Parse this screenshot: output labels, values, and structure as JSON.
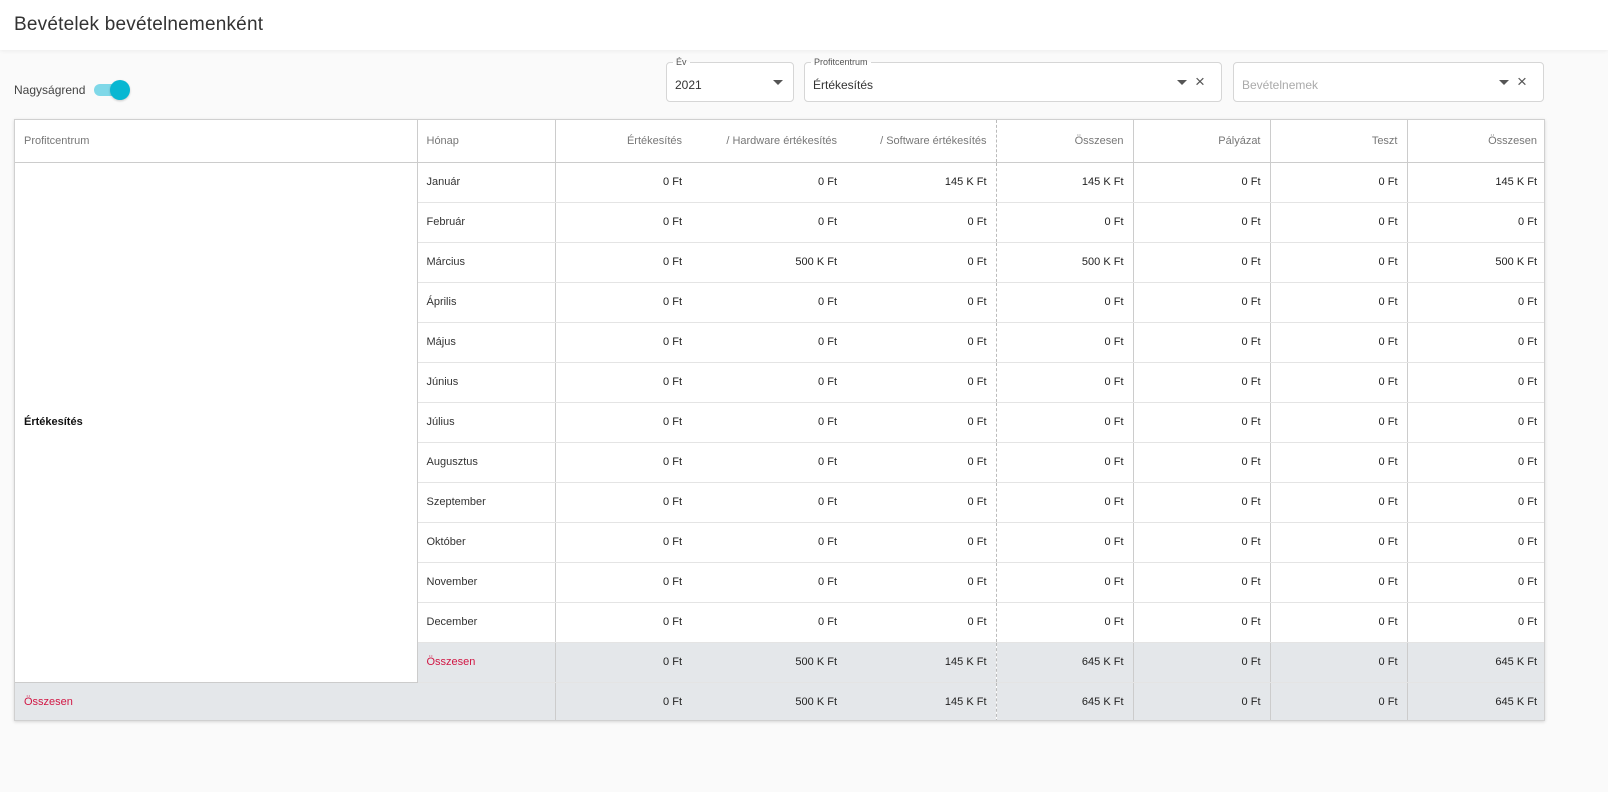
{
  "page": {
    "title": "Bevételek bevételnemenként"
  },
  "toggle": {
    "label": "Nagyságrend",
    "on": true
  },
  "filters": {
    "year": {
      "legend": "Év",
      "value": "2021"
    },
    "profitcenter": {
      "legend": "Profitcentrum",
      "value": "Értékesítés"
    },
    "revenue_types": {
      "placeholder": "Bevételnemek"
    }
  },
  "table": {
    "headers": {
      "profitcenter": "Profitcentrum",
      "month": "Hónap",
      "c1": "Értékesítés",
      "c2": "/ Hardware értékesítés",
      "c3": "/ Software értékesítés",
      "c4": "Összesen",
      "c5": "Pályázat",
      "c6": "Teszt",
      "c7": "Összesen"
    },
    "group_label": "Értékesítés",
    "rows": [
      {
        "month": "Január",
        "values": [
          "0 Ft",
          "0 Ft",
          "145 K Ft",
          "145 K Ft",
          "0 Ft",
          "0 Ft",
          "145 K Ft"
        ]
      },
      {
        "month": "Február",
        "values": [
          "0 Ft",
          "0 Ft",
          "0 Ft",
          "0 Ft",
          "0 Ft",
          "0 Ft",
          "0 Ft"
        ]
      },
      {
        "month": "Március",
        "values": [
          "0 Ft",
          "500 K Ft",
          "0 Ft",
          "500 K Ft",
          "0 Ft",
          "0 Ft",
          "500 K Ft"
        ]
      },
      {
        "month": "Április",
        "values": [
          "0 Ft",
          "0 Ft",
          "0 Ft",
          "0 Ft",
          "0 Ft",
          "0 Ft",
          "0 Ft"
        ]
      },
      {
        "month": "Május",
        "values": [
          "0 Ft",
          "0 Ft",
          "0 Ft",
          "0 Ft",
          "0 Ft",
          "0 Ft",
          "0 Ft"
        ]
      },
      {
        "month": "Június",
        "values": [
          "0 Ft",
          "0 Ft",
          "0 Ft",
          "0 Ft",
          "0 Ft",
          "0 Ft",
          "0 Ft"
        ]
      },
      {
        "month": "Július",
        "values": [
          "0 Ft",
          "0 Ft",
          "0 Ft",
          "0 Ft",
          "0 Ft",
          "0 Ft",
          "0 Ft"
        ]
      },
      {
        "month": "Augusztus",
        "values": [
          "0 Ft",
          "0 Ft",
          "0 Ft",
          "0 Ft",
          "0 Ft",
          "0 Ft",
          "0 Ft"
        ]
      },
      {
        "month": "Szeptember",
        "values": [
          "0 Ft",
          "0 Ft",
          "0 Ft",
          "0 Ft",
          "0 Ft",
          "0 Ft",
          "0 Ft"
        ]
      },
      {
        "month": "Október",
        "values": [
          "0 Ft",
          "0 Ft",
          "0 Ft",
          "0 Ft",
          "0 Ft",
          "0 Ft",
          "0 Ft"
        ]
      },
      {
        "month": "November",
        "values": [
          "0 Ft",
          "0 Ft",
          "0 Ft",
          "0 Ft",
          "0 Ft",
          "0 Ft",
          "0 Ft"
        ]
      },
      {
        "month": "December",
        "values": [
          "0 Ft",
          "0 Ft",
          "0 Ft",
          "0 Ft",
          "0 Ft",
          "0 Ft",
          "0 Ft"
        ]
      }
    ],
    "subtotal": {
      "label": "Összesen",
      "values": [
        "0 Ft",
        "500 K Ft",
        "145 K Ft",
        "645 K Ft",
        "0 Ft",
        "0 Ft",
        "645 K Ft"
      ]
    },
    "total": {
      "label": "Összesen",
      "values": [
        "0 Ft",
        "500 K Ft",
        "145 K Ft",
        "645 K Ft",
        "0 Ft",
        "0 Ft",
        "645 K Ft"
      ]
    }
  },
  "colors": {
    "accent": "#08b7d2",
    "total_text": "#d11744",
    "total_row_bg": "#e4e7ea"
  }
}
